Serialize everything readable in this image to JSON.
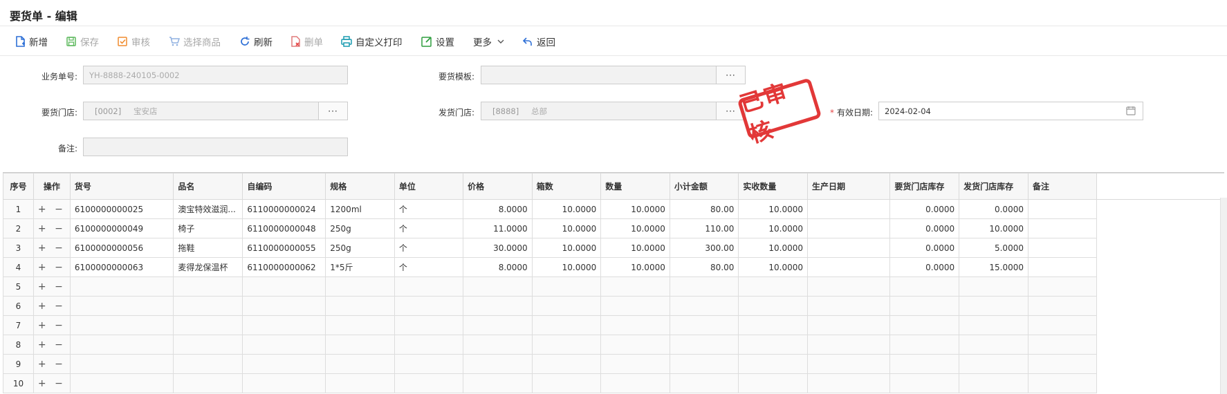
{
  "window": {
    "title": "要货单 - 编辑"
  },
  "toolbar": {
    "new": "新增",
    "save": "保存",
    "audit": "审核",
    "select_goods": "选择商品",
    "refresh": "刷新",
    "delete": "删单",
    "custom_print": "自定义打印",
    "settings": "设置",
    "more": "更多",
    "back": "返回"
  },
  "form": {
    "bill_no_label": "业务单号:",
    "bill_no_value": "YH-8888-240105-0002",
    "template_label": "要货模板:",
    "template_value": "",
    "req_store_label": "要货门店:",
    "req_store_code": "[0002]",
    "req_store_name": "宝安店",
    "ship_store_label": "发货门店:",
    "ship_store_code": "[8888]",
    "ship_store_name": "总部",
    "valid_date_label": "有效日期:",
    "valid_date_value": "2024-02-04",
    "remark_label": "备注:",
    "remark_value": "",
    "dots": "···",
    "required_mark": "*"
  },
  "stamp": "已审核",
  "table": {
    "headers": [
      "序号",
      "操作",
      "货号",
      "品名",
      "自编码",
      "规格",
      "单位",
      "价格",
      "箱数",
      "数量",
      "小计金额",
      "实收数量",
      "生产日期",
      "要货门店库存",
      "发货门店库存",
      "备注"
    ],
    "rows": [
      {
        "idx": "1",
        "ops": "+ −",
        "code": "6100000000025",
        "name": "澳宝特效滋润...",
        "selfcode": "6110000000024",
        "spec": "1200ml",
        "unit": "个",
        "price": "8.0000",
        "boxes": "10.0000",
        "qty": "10.0000",
        "subtotal": "80.00",
        "recv": "10.0000",
        "pdate": "",
        "req_stock": "0.0000",
        "ship_stock": "0.0000",
        "remark": ""
      },
      {
        "idx": "2",
        "ops": "+ −",
        "code": "6100000000049",
        "name": "椅子",
        "selfcode": "6110000000048",
        "spec": "250g",
        "unit": "个",
        "price": "11.0000",
        "boxes": "10.0000",
        "qty": "10.0000",
        "subtotal": "110.00",
        "recv": "10.0000",
        "pdate": "",
        "req_stock": "0.0000",
        "ship_stock": "10.0000",
        "remark": ""
      },
      {
        "idx": "3",
        "ops": "+ −",
        "code": "6100000000056",
        "name": "拖鞋",
        "selfcode": "6110000000055",
        "spec": "250g",
        "unit": "个",
        "price": "30.0000",
        "boxes": "10.0000",
        "qty": "10.0000",
        "subtotal": "300.00",
        "recv": "10.0000",
        "pdate": "",
        "req_stock": "0.0000",
        "ship_stock": "5.0000",
        "remark": ""
      },
      {
        "idx": "4",
        "ops": "+ −",
        "code": "6100000000063",
        "name": "麦得龙保温杯",
        "selfcode": "6110000000062",
        "spec": "1*5斤",
        "unit": "个",
        "price": "8.0000",
        "boxes": "10.0000",
        "qty": "10.0000",
        "subtotal": "80.00",
        "recv": "10.0000",
        "pdate": "",
        "req_stock": "0.0000",
        "ship_stock": "15.0000",
        "remark": ""
      },
      {
        "idx": "5",
        "ops": "+ −"
      },
      {
        "idx": "6",
        "ops": "+ −"
      },
      {
        "idx": "7",
        "ops": "+ −"
      },
      {
        "idx": "8",
        "ops": "+ −"
      },
      {
        "idx": "9",
        "ops": "+ −"
      },
      {
        "idx": "10",
        "ops": "+ −"
      }
    ]
  },
  "colors": {
    "accent_blue": "#2d6fd6",
    "stamp_red": "#e02828",
    "required_red": "#e54545"
  }
}
